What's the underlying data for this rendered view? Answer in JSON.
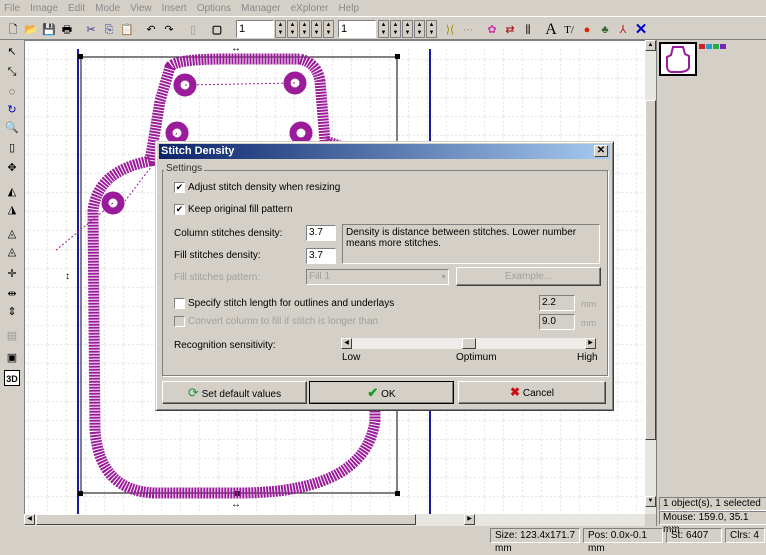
{
  "menu": [
    "File",
    "Image",
    "Edit",
    "Mode",
    "View",
    "Insert",
    "Options",
    "Manager",
    "eXplorer",
    "Help"
  ],
  "toolbar": {
    "field1": "1",
    "field2": "1"
  },
  "dialog": {
    "title": "Stitch Density",
    "close": "✕",
    "group": "Settings",
    "adjust": {
      "label": "Adjust stitch density when resizing",
      "checked": true
    },
    "keep": {
      "label": "Keep original fill pattern",
      "checked": true
    },
    "column_label": "Column stitches density:",
    "column_value": "3.7",
    "fill_label": "Fill stitches density:",
    "fill_value": "3.7",
    "hint": "Density is distance between stitches. Lower number means more stitches.",
    "pattern_label": "Fill stitches pattern:",
    "pattern_value": "Fill 1",
    "example": "Example...",
    "specify": {
      "label": "Specify stitch length for outlines and underlays",
      "checked": false,
      "value": "2.2",
      "unit": "mm"
    },
    "convert": {
      "label": "Convert column to fill if stitch is longer than",
      "checked": false,
      "value": "9.0",
      "unit": "mm"
    },
    "recognition_label": "Recognition sensitivity:",
    "slider": {
      "low": "Low",
      "mid": "Optimum",
      "high": "High",
      "value": 0.5
    },
    "defaults": "Set default values",
    "ok": "OK",
    "cancel": "Cancel"
  },
  "right": {
    "objects": "1 object(s), 1 selected",
    "mouse": "Mouse: 159.0, 35.1 mm"
  },
  "status": {
    "size": "Size: 123.4x171.7 mm",
    "pos": "Pos: 0.0x-0.1 mm",
    "st": "St: 6407",
    "clrs": "Clrs: 4"
  },
  "colors": {
    "thread": "#9b1c9b",
    "page": "#1a1aa0",
    "swatches": [
      "#d02020",
      "#20a0d0",
      "#20b040",
      "#8020c0"
    ]
  }
}
